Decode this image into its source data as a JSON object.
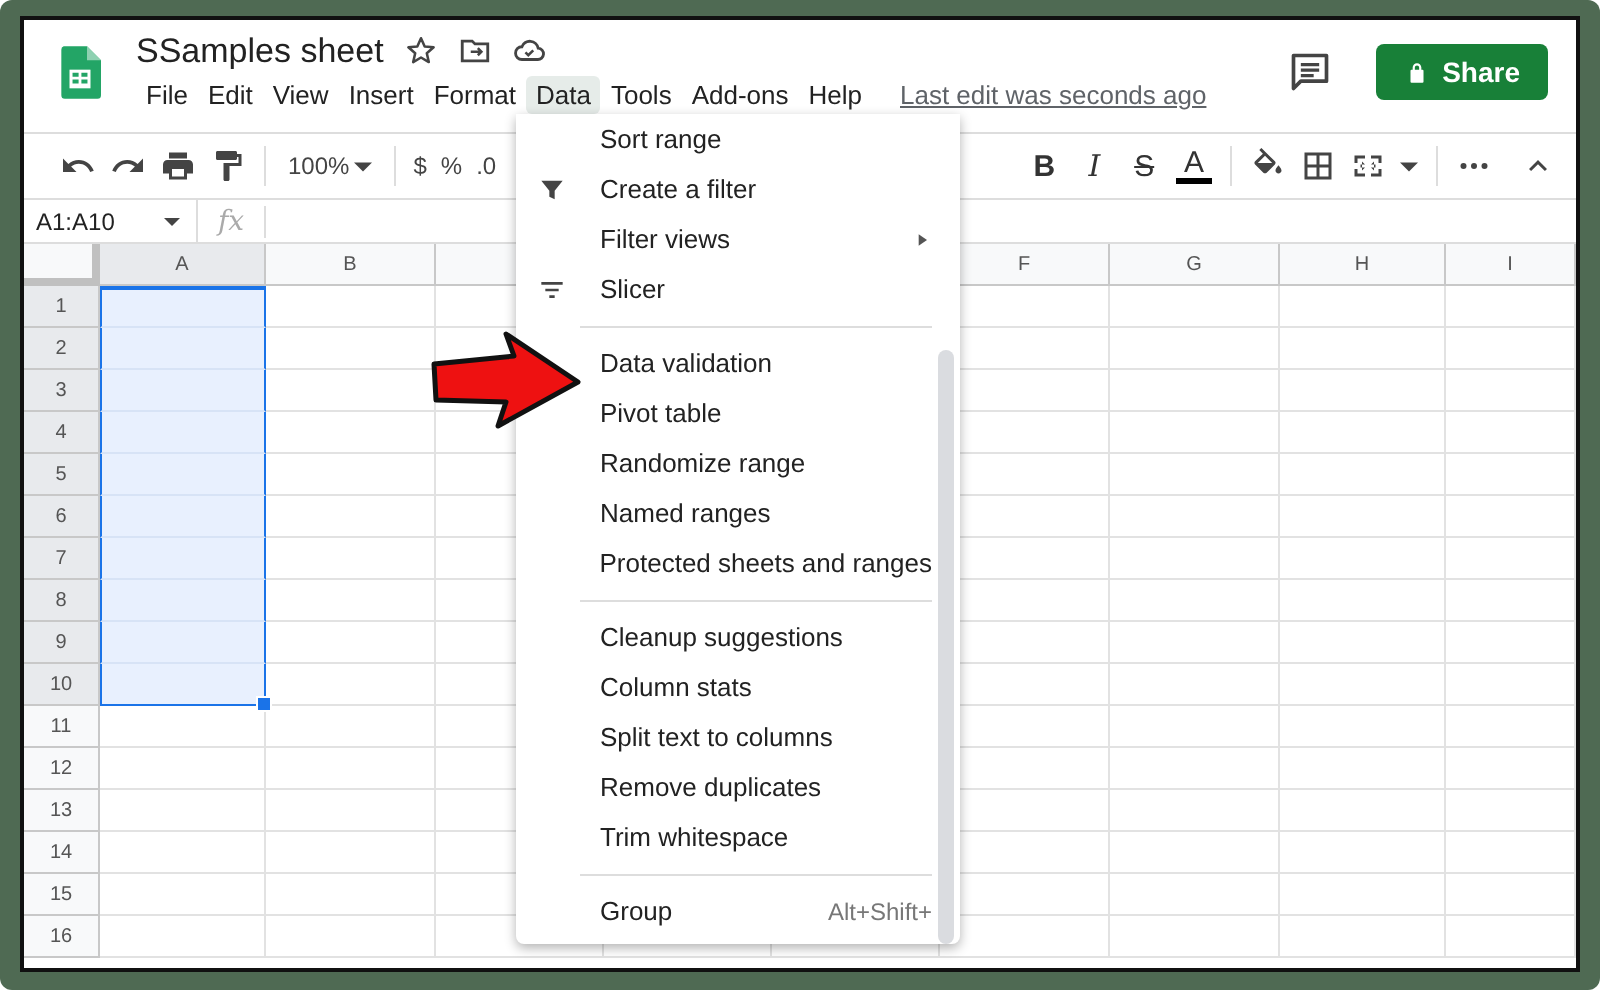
{
  "window": {
    "title": "SSamples sheet"
  },
  "menu_bar": [
    {
      "label": "File",
      "selected": false
    },
    {
      "label": "Edit",
      "selected": false
    },
    {
      "label": "View",
      "selected": false
    },
    {
      "label": "Insert",
      "selected": false
    },
    {
      "label": "Format",
      "selected": false
    },
    {
      "label": "Data",
      "selected": true
    },
    {
      "label": "Tools",
      "selected": false
    },
    {
      "label": "Add-ons",
      "selected": false
    },
    {
      "label": "Help",
      "selected": false
    }
  ],
  "last_edit": "Last edit was seconds ago",
  "share_button": "Share",
  "toolbar": {
    "zoom": "100%",
    "number_formats": [
      "$",
      "%",
      ".0"
    ],
    "text_formats": [
      "B",
      "I",
      "S",
      "A"
    ]
  },
  "formula_bar": {
    "name_box": "A1:A10",
    "function_label": "fx"
  },
  "grid": {
    "columns_left": [
      {
        "label": "A",
        "selected": true
      },
      {
        "label": "B",
        "selected": false
      }
    ],
    "columns_right": [
      {
        "label": "F",
        "selected": false
      },
      {
        "label": "G",
        "selected": false
      },
      {
        "label": "H",
        "selected": false
      },
      {
        "label": "I",
        "selected": false
      }
    ],
    "rows": [
      {
        "label": "1",
        "selected": true
      },
      {
        "label": "2",
        "selected": true
      },
      {
        "label": "3",
        "selected": true
      },
      {
        "label": "4",
        "selected": true
      },
      {
        "label": "5",
        "selected": true
      },
      {
        "label": "6",
        "selected": true
      },
      {
        "label": "7",
        "selected": true
      },
      {
        "label": "8",
        "selected": true
      },
      {
        "label": "9",
        "selected": true
      },
      {
        "label": "10",
        "selected": true
      },
      {
        "label": "11",
        "selected": false
      },
      {
        "label": "12",
        "selected": false
      },
      {
        "label": "13",
        "selected": false
      },
      {
        "label": "14",
        "selected": false
      },
      {
        "label": "15",
        "selected": false
      },
      {
        "label": "16",
        "selected": false
      }
    ]
  },
  "data_menu": [
    {
      "kind": "plain",
      "label": "Sort range"
    },
    {
      "kind": "filter",
      "label": "Create a filter"
    },
    {
      "kind": "submenu",
      "label": "Filter views"
    },
    {
      "kind": "slicer",
      "label": "Slicer"
    },
    {
      "kind": "separator"
    },
    {
      "kind": "plain",
      "label": "Data validation"
    },
    {
      "kind": "plain",
      "label": "Pivot table"
    },
    {
      "kind": "plain",
      "label": "Randomize range"
    },
    {
      "kind": "plain",
      "label": "Named ranges"
    },
    {
      "kind": "plain",
      "label": "Protected sheets and ranges"
    },
    {
      "kind": "separator"
    },
    {
      "kind": "plain",
      "label": "Cleanup suggestions"
    },
    {
      "kind": "plain",
      "label": "Column stats"
    },
    {
      "kind": "plain",
      "label": "Split text to columns"
    },
    {
      "kind": "plain",
      "label": "Remove duplicates"
    },
    {
      "kind": "plain",
      "label": "Trim whitespace"
    },
    {
      "kind": "separator"
    },
    {
      "kind": "shortcut",
      "label": "Group",
      "shortcut": "Alt+Shift+"
    }
  ]
}
